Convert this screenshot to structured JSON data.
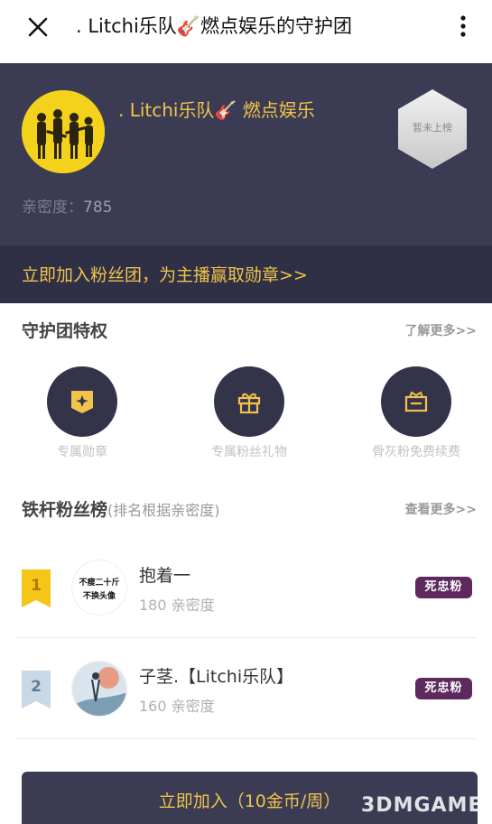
{
  "topbar": {
    "title": ". Litchi乐队🎸燃点娱乐的守护团"
  },
  "hero": {
    "anchor_name": ". Litchi乐队🎸 燃点娱乐",
    "affinity_label": "亲密度：",
    "affinity_value": "785",
    "rank_badge": "暂未上榜"
  },
  "join_banner": {
    "text": "立即加入粉丝团，为主播赢取勋章>>"
  },
  "privileges": {
    "title": "守护团特权",
    "more": "了解更多>>",
    "items": [
      {
        "label": "专属勋章",
        "icon": "badge-icon"
      },
      {
        "label": "专属粉丝礼物",
        "icon": "gift-icon"
      },
      {
        "label": "骨灰粉免费续费",
        "icon": "ticket-icon"
      }
    ]
  },
  "fan_rank": {
    "title": "铁杆粉丝榜",
    "subtitle": "(排名根据亲密度)",
    "more": "查看更多>>",
    "items": [
      {
        "rank": "1",
        "name": "抱着一",
        "score": "180 亲密度",
        "badge": "死忠粉",
        "avatar_text_1": "不瘦二十斤",
        "avatar_text_2": "不换头像",
        "rank_color": "#f5c518"
      },
      {
        "rank": "2",
        "name": "子茎.【Litchi乐队】",
        "score": "160 亲密度",
        "badge": "死忠粉",
        "rank_color": "#c9d8e6"
      }
    ]
  },
  "bottom_button": {
    "label": "立即加入（10金币/周）"
  },
  "watermark": {
    "text": "3DMGAME"
  },
  "colors": {
    "accent": "#f1c34b",
    "hero_bg": "#3b3c53",
    "badge_bg": "#5e2a5d"
  }
}
